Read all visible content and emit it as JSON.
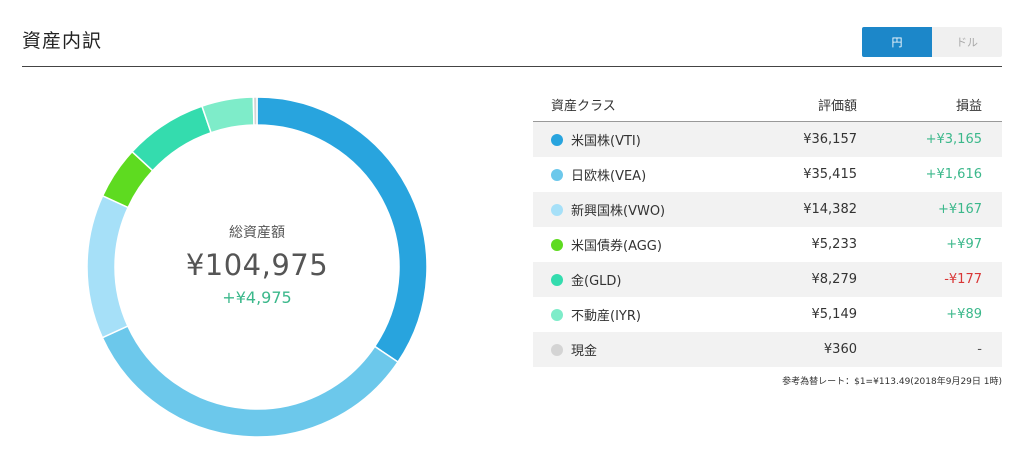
{
  "header": {
    "title": "資産内訳"
  },
  "currency_toggle": {
    "yen_label": "円",
    "dollar_label": "ドル",
    "selected": "円"
  },
  "summary": {
    "label": "総資産額",
    "total": "¥104,975",
    "gain": "+¥4,975"
  },
  "table": {
    "headers": {
      "asset_class": "資産クラス",
      "valuation": "評価額",
      "pnl": "損益"
    },
    "rows": [
      {
        "name": "米国株(VTI)",
        "value": "¥36,157",
        "pnl": "+¥3,165",
        "sign": "pos",
        "color": "#28a4de",
        "amount": 36157
      },
      {
        "name": "日欧株(VEA)",
        "value": "¥35,415",
        "pnl": "+¥1,616",
        "sign": "pos",
        "color": "#6cc8eb",
        "amount": 35415
      },
      {
        "name": "新興国株(VWO)",
        "value": "¥14,382",
        "pnl": "+¥167",
        "sign": "pos",
        "color": "#a6e0f8",
        "amount": 14382
      },
      {
        "name": "米国債券(AGG)",
        "value": "¥5,233",
        "pnl": "+¥97",
        "sign": "pos",
        "color": "#5edb20",
        "amount": 5233
      },
      {
        "name": "金(GLD)",
        "value": "¥8,279",
        "pnl": "-¥177",
        "sign": "neg",
        "color": "#34dcae",
        "amount": 8279
      },
      {
        "name": "不動産(IYR)",
        "value": "¥5,149",
        "pnl": "+¥89",
        "sign": "pos",
        "color": "#7eecc9",
        "amount": 5149
      },
      {
        "name": "現金",
        "value": "¥360",
        "pnl": "-",
        "sign": "neu",
        "color": "#d4d4d4",
        "amount": 360
      }
    ]
  },
  "footnote": "参考為替レート：$1=¥113.49(2018年9月29日 1時)"
}
